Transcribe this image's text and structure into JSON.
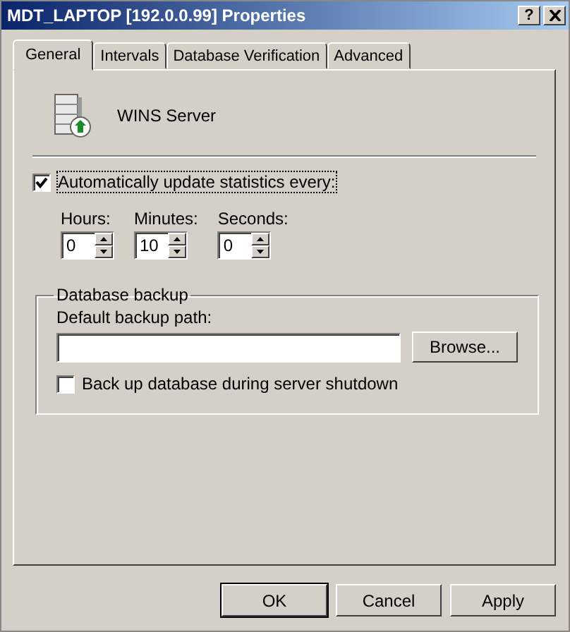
{
  "window": {
    "title": "MDT_LAPTOP [192.0.0.99] Properties",
    "help": "?"
  },
  "tabs": [
    {
      "label": "General",
      "selected": true
    },
    {
      "label": "Intervals",
      "selected": false
    },
    {
      "label": "Database Verification",
      "selected": false
    },
    {
      "label": "Advanced",
      "selected": false
    }
  ],
  "server": {
    "name": "WINS Server"
  },
  "auto_update": {
    "label": "Automatically update statistics every:",
    "checked": true
  },
  "spinners": [
    {
      "label": "Hours:",
      "value": "0"
    },
    {
      "label": "Minutes:",
      "value": "10"
    },
    {
      "label": "Seconds:",
      "value": "0"
    }
  ],
  "backup": {
    "title": "Database backup",
    "path_label": "Default backup path:",
    "browse": "Browse...",
    "shutdown": {
      "label": "Back up database during server shutdown",
      "checked": false
    }
  },
  "buttons": [
    "OK",
    "Cancel",
    "Apply"
  ]
}
